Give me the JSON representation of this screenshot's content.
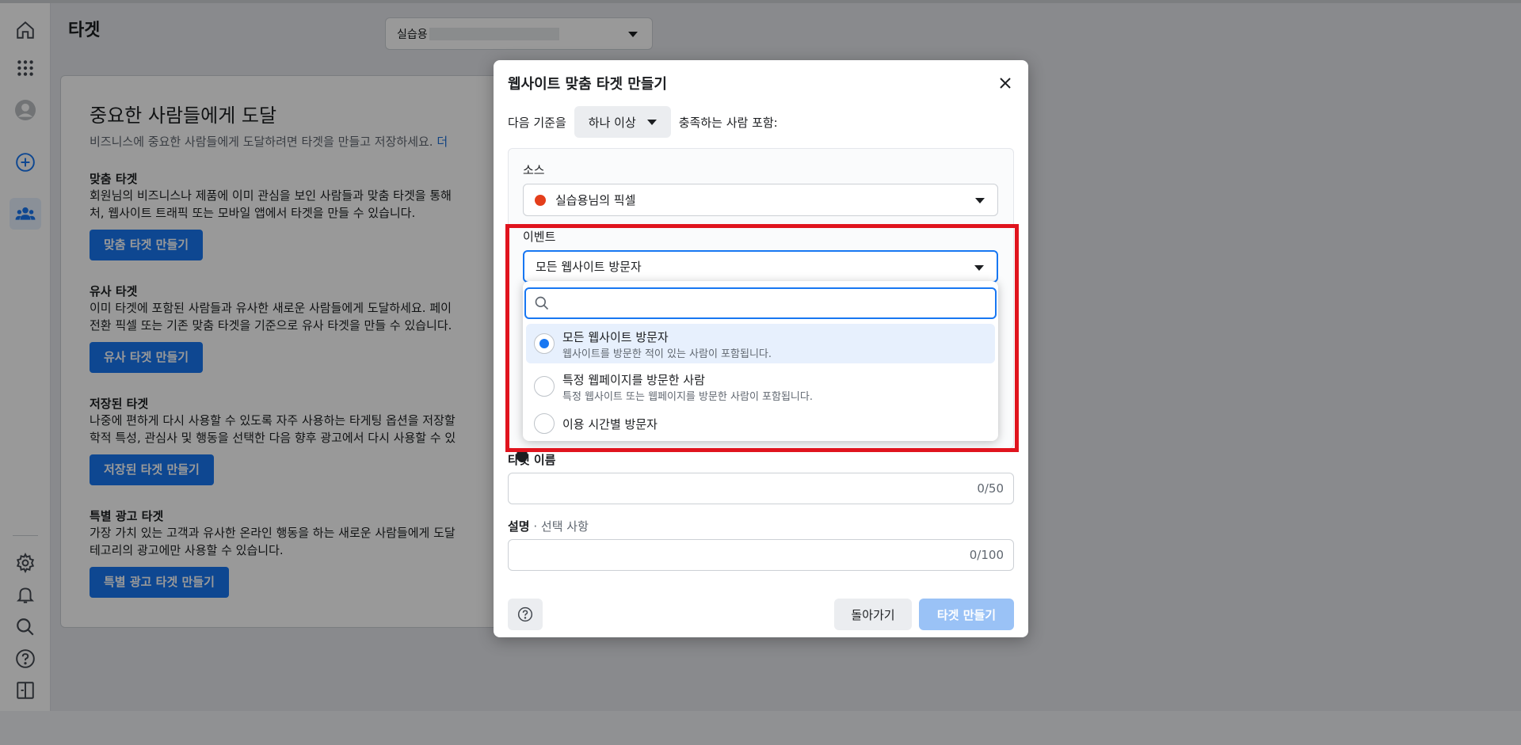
{
  "page": {
    "title": "타겟",
    "account_select_prefix": "실습용"
  },
  "card": {
    "heading": "중요한 사람들에게 도달",
    "desc": "비즈니스에 중요한 사람들에게 도달하려면 타겟을 만들고 저장하세요. ",
    "desc_link": "더",
    "sections": [
      {
        "title": "맞춤 타겟",
        "line1": "회원님의 비즈니스나 제품에 이미 관심을 보인 사람들과 맞춤 타겟을 통해",
        "line2": "처, 웹사이트 트래픽 또는 모바일 앱에서 타겟을 만들 수 있습니다.",
        "button": "맞춤 타겟 만들기"
      },
      {
        "title": "유사 타겟",
        "line1": "이미 타겟에 포함된 사람들과 유사한 새로운 사람들에게 도달하세요. 페이",
        "line2": "전환 픽셀 또는 기존 맞춤 타겟을 기준으로 유사 타겟을 만들 수 있습니다.",
        "button": "유사 타겟 만들기"
      },
      {
        "title": "저장된 타겟",
        "line1": "나중에 편하게 다시 사용할 수 있도록 자주 사용하는 타게팅 옵션을 저장할",
        "line2": "학적 특성, 관심사 및 행동을 선택한 다음 향후 광고에서 다시 사용할 수 있",
        "button": "저장된 타겟 만들기"
      },
      {
        "title": "특별 광고 타겟",
        "line1": "가장 가치 있는 고객과 유사한 온라인 행동을 하는 새로운 사람들에게 도달",
        "line2": "테고리의 광고에만 사용할 수 있습니다.",
        "button": "특별 광고 타겟 만들기"
      }
    ]
  },
  "modal": {
    "title": "웹사이트 맞춤 타겟 만들기",
    "criteria_prefix": "다음 기준을",
    "criteria_value": "하나 이상",
    "criteria_suffix": "충족하는 사람 포함:",
    "source_label": "소스",
    "source_value": "실습용님의 픽셀",
    "event_label": "이벤트",
    "event_value": "모든 웹사이트 방문자",
    "name_label": "타겟 이름",
    "name_counter": "0/50",
    "desc_label": "설명",
    "desc_optional": " · 선택 사항",
    "desc_counter": "0/100",
    "back_button": "돌아가기",
    "create_button": "타겟 만들기"
  },
  "dropdown": {
    "search_placeholder": "",
    "options": [
      {
        "title": "모든 웹사이트 방문자",
        "sub": "웹사이트를 방문한 적이 있는 사람이 포함됩니다.",
        "selected": true
      },
      {
        "title": "특정 웹페이지를 방문한 사람",
        "sub": "특정 웹사이트 또는 웹페이지를 방문한 사람이 포함됩니다.",
        "selected": false
      },
      {
        "title": "이용 시간별 방문자",
        "sub": "",
        "selected": false
      }
    ]
  },
  "colors": {
    "primary": "#1877f2",
    "highlight": "#e0141e",
    "pixel_dot": "#e43e1b"
  }
}
